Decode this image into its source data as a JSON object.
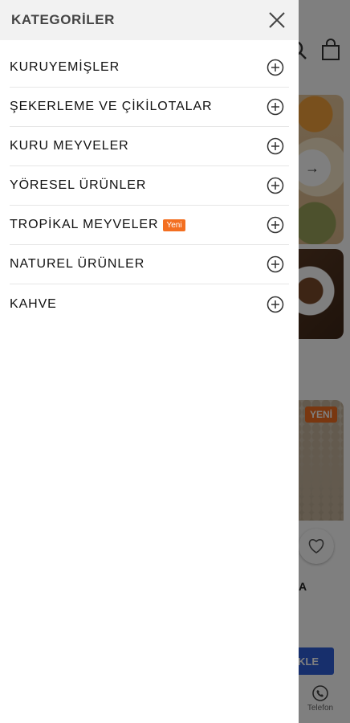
{
  "drawer": {
    "title": "KATEGORİLER",
    "categories": [
      {
        "label": "KURUYEMİŞLER",
        "badge": ""
      },
      {
        "label": "ŞEKERLEME VE ÇİKİLOTALAR",
        "badge": ""
      },
      {
        "label": "KURU MEYVELER",
        "badge": ""
      },
      {
        "label": "YÖRESEL ÜRÜNLER",
        "badge": ""
      },
      {
        "label": "TROPİKAL MEYVELER",
        "badge": "Yeni"
      },
      {
        "label": "NATUREL ÜRÜNLER",
        "badge": ""
      },
      {
        "label": "KAHVE",
        "badge": ""
      }
    ],
    "icons": {
      "close": "close-icon",
      "expand": "plus-circle-icon"
    }
  },
  "background": {
    "badge": "YENİ",
    "product_name_fragment": "A",
    "add_button_fragment": "KLE",
    "phone_label": "Telefon",
    "icons": [
      "search-icon",
      "bag-icon",
      "arrow-right-icon",
      "heart-icon",
      "phone-icon"
    ]
  },
  "colors": {
    "badge": "#f36f21",
    "button": "#2f5fd8",
    "header_bg": "#f2f2f2"
  }
}
